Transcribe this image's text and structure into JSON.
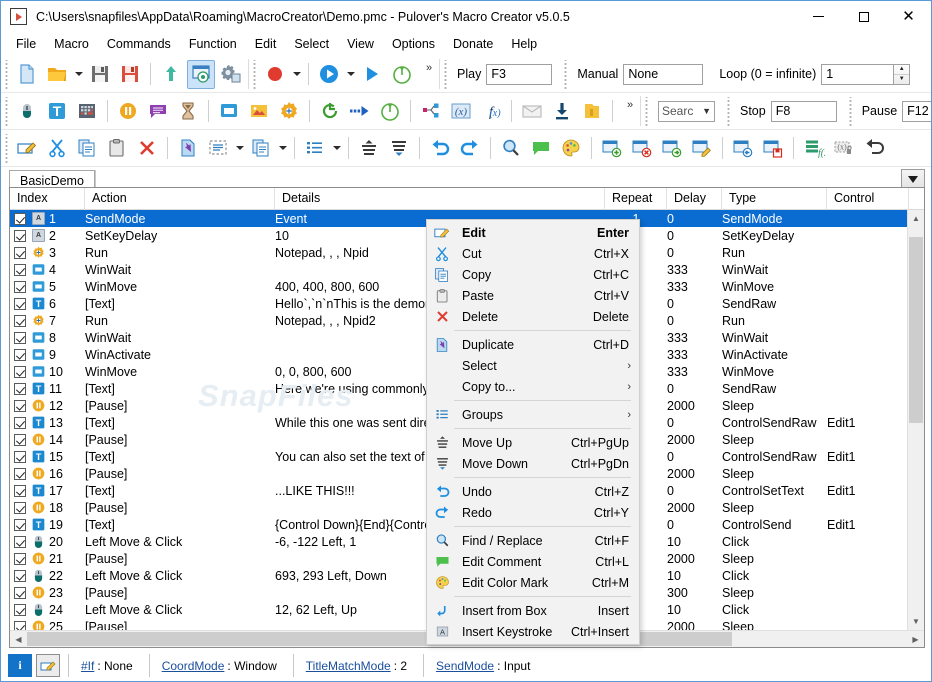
{
  "window": {
    "title": "C:\\Users\\snapfiles\\AppData\\Roaming\\MacroCreator\\Demo.pmc - Pulover's Macro Creator v5.0.5",
    "app_icon": "play-document-icon",
    "minimize": "—",
    "maximize": "□",
    "close": "✕"
  },
  "menubar": [
    {
      "label": "File"
    },
    {
      "label": "Macro"
    },
    {
      "label": "Commands"
    },
    {
      "label": "Function"
    },
    {
      "label": "Edit"
    },
    {
      "label": "Select"
    },
    {
      "label": "View"
    },
    {
      "label": "Options"
    },
    {
      "label": "Donate"
    },
    {
      "label": "Help"
    }
  ],
  "toolbar": {
    "row1": {
      "icons": [
        "new-file-icon",
        "open-folder-icon",
        "save-icon",
        "save-as-icon",
        "export-up-icon",
        "show-hide-icon",
        "settings-icon"
      ],
      "record_icons": [
        "record-icon",
        "play-icon",
        "play-step-icon",
        "timer-icon"
      ],
      "overflow": "»"
    },
    "row2": {
      "icons": [
        "mouse-icon",
        "text-icon",
        "keystroke-icon",
        "pause-icon",
        "comment-icon",
        "wait-icon",
        "window-icon",
        "image-search-icon",
        "control-icon",
        "loop-icon",
        "goto-icon",
        "timer-loop-icon",
        "group-icon",
        "variable-icon",
        "function-icon",
        "mail-icon",
        "download-icon",
        "file-ops-icon"
      ],
      "overflow": "»"
    },
    "row3": {
      "icons": [
        "edit-icon",
        "cut-icon",
        "copy-icon",
        "paste-icon",
        "delete-icon",
        "duplicate-icon",
        "select-icon",
        "copy-to-icon",
        "list-icon",
        "move-up-icon",
        "move-down-icon",
        "undo-icon",
        "redo-icon",
        "find-replace-icon",
        "comment-edit-icon",
        "color-mark-icon",
        "insert-row-icon",
        "delete-row-icon",
        "insert-after-icon",
        "edit-row-icon",
        "insert-before-icon",
        "save-row-icon",
        "variables-icon",
        "lock-var-icon",
        "restore-icon"
      ]
    },
    "play_label": "Play",
    "play_value": "F3",
    "manual_label": "Manual",
    "manual_value": "None",
    "loop_label": "Loop (0 = infinite)",
    "loop_value": "1",
    "search_value": "Searc",
    "stop_label": "Stop",
    "stop_value": "F8",
    "pause_label": "Pause",
    "pause_value": "F12"
  },
  "tabs": {
    "items": [
      {
        "label": "BasicDemo",
        "active": true
      }
    ],
    "dropdown": "tab-list-dropdown"
  },
  "table": {
    "columns": [
      "Index",
      "Action",
      "Details",
      "Repeat",
      "Delay",
      "Type",
      "Control"
    ],
    "rows": [
      {
        "checked": true,
        "icon": "key",
        "glyph": "A",
        "index": "1",
        "action": "SendMode",
        "details": "Event",
        "repeat": "1",
        "delay": "0",
        "type": "SendMode",
        "control": "",
        "selected": true
      },
      {
        "checked": true,
        "icon": "key",
        "glyph": "A",
        "index": "2",
        "action": "SetKeyDelay",
        "details": "10",
        "repeat": "",
        "delay": "0",
        "type": "SetKeyDelay",
        "control": ""
      },
      {
        "checked": true,
        "icon": "gear",
        "glyph": "",
        "index": "3",
        "action": "Run",
        "details": "Notepad, , , Npid",
        "repeat": "",
        "delay": "0",
        "type": "Run",
        "control": ""
      },
      {
        "checked": true,
        "icon": "win",
        "glyph": "▭",
        "index": "4",
        "action": "WinWait",
        "details": "",
        "repeat": "",
        "delay": "333",
        "type": "WinWait",
        "control": ""
      },
      {
        "checked": true,
        "icon": "win",
        "glyph": "▭",
        "index": "5",
        "action": "WinMove",
        "details": "400, 400, 800, 600",
        "repeat": "",
        "delay": "333",
        "type": "WinMove",
        "control": ""
      },
      {
        "checked": true,
        "icon": "txt",
        "glyph": "T",
        "index": "6",
        "action": "[Text]",
        "details": "Hello`,`n`nThis is the demonstrati",
        "repeat": "",
        "delay": "0",
        "type": "SendRaw",
        "control": ""
      },
      {
        "checked": true,
        "icon": "gear",
        "glyph": "",
        "index": "7",
        "action": "Run",
        "details": "Notepad, , , Npid2",
        "repeat": "",
        "delay": "0",
        "type": "Run",
        "control": ""
      },
      {
        "checked": true,
        "icon": "win",
        "glyph": "▭",
        "index": "8",
        "action": "WinWait",
        "details": "",
        "repeat": "",
        "delay": "333",
        "type": "WinWait",
        "control": ""
      },
      {
        "checked": true,
        "icon": "win",
        "glyph": "▭",
        "index": "9",
        "action": "WinActivate",
        "details": "",
        "repeat": "",
        "delay": "333",
        "type": "WinActivate",
        "control": ""
      },
      {
        "checked": true,
        "icon": "win",
        "glyph": "▭",
        "index": "10",
        "action": "WinMove",
        "details": "0, 0, 800, 600",
        "repeat": "",
        "delay": "333",
        "type": "WinMove",
        "control": ""
      },
      {
        "checked": true,
        "icon": "txt",
        "glyph": "T",
        "index": "11",
        "action": "[Text]",
        "details": "Here we're using commonly used",
        "repeat": "",
        "delay": "0",
        "type": "SendRaw",
        "control": ""
      },
      {
        "checked": true,
        "icon": "pause",
        "glyph": "",
        "index": "12",
        "action": "[Pause]",
        "details": "",
        "repeat": "",
        "delay": "2000",
        "type": "Sleep",
        "control": ""
      },
      {
        "checked": true,
        "icon": "txt",
        "glyph": "T",
        "index": "13",
        "action": "[Text]",
        "details": "While this one was sent directly t",
        "repeat": "",
        "delay": "0",
        "type": "ControlSendRaw",
        "control": "Edit1"
      },
      {
        "checked": true,
        "icon": "pause",
        "glyph": "",
        "index": "14",
        "action": "[Pause]",
        "details": "",
        "repeat": "",
        "delay": "2000",
        "type": "Sleep",
        "control": ""
      },
      {
        "checked": true,
        "icon": "txt",
        "glyph": "T",
        "index": "15",
        "action": "[Text]",
        "details": "You can also set the text of the ",
        "repeat": "",
        "delay": "0",
        "type": "ControlSendRaw",
        "control": "Edit1"
      },
      {
        "checked": true,
        "icon": "pause",
        "glyph": "",
        "index": "16",
        "action": "[Pause]",
        "details": "",
        "repeat": "",
        "delay": "2000",
        "type": "Sleep",
        "control": ""
      },
      {
        "checked": true,
        "icon": "txt",
        "glyph": "T",
        "index": "17",
        "action": "[Text]",
        "details": "...LIKE THIS!!!",
        "repeat": "",
        "delay": "0",
        "type": "ControlSetText",
        "control": "Edit1"
      },
      {
        "checked": true,
        "icon": "pause",
        "glyph": "",
        "index": "18",
        "action": "[Pause]",
        "details": "",
        "repeat": "",
        "delay": "2000",
        "type": "Sleep",
        "control": ""
      },
      {
        "checked": true,
        "icon": "txt",
        "glyph": "T",
        "index": "19",
        "action": "[Text]",
        "details": "{Control Down}{End}{Control UP",
        "repeat": "",
        "delay": "0",
        "type": "ControlSend",
        "control": "Edit1"
      },
      {
        "checked": true,
        "icon": "mouse",
        "glyph": "",
        "index": "20",
        "action": "Left Move & Click",
        "details": "-6, -122 Left, 1",
        "repeat": "",
        "delay": "10",
        "type": "Click",
        "control": ""
      },
      {
        "checked": true,
        "icon": "pause",
        "glyph": "",
        "index": "21",
        "action": "[Pause]",
        "details": "",
        "repeat": "",
        "delay": "2000",
        "type": "Sleep",
        "control": ""
      },
      {
        "checked": true,
        "icon": "mouse",
        "glyph": "",
        "index": "22",
        "action": "Left Move & Click",
        "details": "693, 293 Left, Down",
        "repeat": "",
        "delay": "10",
        "type": "Click",
        "control": ""
      },
      {
        "checked": true,
        "icon": "pause",
        "glyph": "",
        "index": "23",
        "action": "[Pause]",
        "details": "",
        "repeat": "",
        "delay": "300",
        "type": "Sleep",
        "control": ""
      },
      {
        "checked": true,
        "icon": "mouse",
        "glyph": "",
        "index": "24",
        "action": "Left Move & Click",
        "details": "12, 62 Left, Up",
        "repeat": "",
        "delay": "10",
        "type": "Click",
        "control": ""
      },
      {
        "checked": true,
        "icon": "pause",
        "glyph": "",
        "index": "25",
        "action": "[Pause]",
        "details": "",
        "repeat": "",
        "delay": "2000",
        "type": "Sleep",
        "control": ""
      }
    ]
  },
  "watermark": "SnapFiles",
  "context_menu": {
    "groups": [
      [
        {
          "icon": "edit-icon",
          "label": "Edit",
          "shortcut": "Enter",
          "bold": true
        },
        {
          "icon": "cut-icon",
          "label": "Cut",
          "shortcut": "Ctrl+X"
        },
        {
          "icon": "copy-icon",
          "label": "Copy",
          "shortcut": "Ctrl+C"
        },
        {
          "icon": "paste-icon",
          "label": "Paste",
          "shortcut": "Ctrl+V"
        },
        {
          "icon": "delete-icon",
          "label": "Delete",
          "shortcut": "Delete"
        }
      ],
      [
        {
          "icon": "duplicate-icon",
          "label": "Duplicate",
          "shortcut": "Ctrl+D"
        },
        {
          "icon": "",
          "label": "Select",
          "submenu": true
        },
        {
          "icon": "",
          "label": "Copy to...",
          "submenu": true
        }
      ],
      [
        {
          "icon": "groups-icon",
          "label": "Groups",
          "submenu": true
        }
      ],
      [
        {
          "icon": "move-up-icon",
          "label": "Move Up",
          "shortcut": "Ctrl+PgUp"
        },
        {
          "icon": "move-down-icon",
          "label": "Move Down",
          "shortcut": "Ctrl+PgDn"
        }
      ],
      [
        {
          "icon": "undo-icon",
          "label": "Undo",
          "shortcut": "Ctrl+Z"
        },
        {
          "icon": "redo-icon",
          "label": "Redo",
          "shortcut": "Ctrl+Y"
        }
      ],
      [
        {
          "icon": "find-icon",
          "label": "Find / Replace",
          "shortcut": "Ctrl+F"
        },
        {
          "icon": "comment-icon",
          "label": "Edit Comment",
          "shortcut": "Ctrl+L"
        },
        {
          "icon": "palette-icon",
          "label": "Edit Color Mark",
          "shortcut": "Ctrl+M"
        }
      ],
      [
        {
          "icon": "insert-box-icon",
          "label": "Insert from Box",
          "shortcut": "Insert"
        },
        {
          "icon": "keystroke-icon",
          "label": "Insert Keystroke",
          "shortcut": "Ctrl+Insert"
        }
      ]
    ]
  },
  "statusbar": {
    "info_icon": "info-icon",
    "edit_icon": "edit-pencil-icon",
    "cells": [
      {
        "link": "#If",
        "value": ": None"
      },
      {
        "link": "CoordMode",
        "value": ": Window"
      },
      {
        "link": "TitleMatchMode",
        "value": ": 2"
      },
      {
        "link": "SendMode",
        "value": ": Input"
      }
    ]
  },
  "colors": {
    "selection": "#0a6cd0",
    "accent": "#1273c9",
    "window_border": "#5b9bd5"
  }
}
